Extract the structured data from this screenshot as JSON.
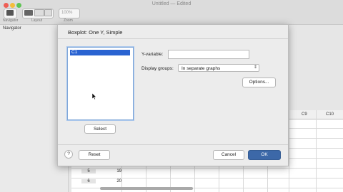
{
  "window": {
    "title": "Untitled — Edited"
  },
  "toolbar": {
    "labels": {
      "navigator": "Navigator",
      "layout": "Layout",
      "zoom": "Zoom"
    },
    "zoom_value": "100%"
  },
  "navigator": {
    "title": "Navigator"
  },
  "worksheet": {
    "columns": [
      "C9",
      "C10"
    ],
    "rows": [
      {
        "num": "5",
        "value": "19"
      },
      {
        "num": "6",
        "value": "20"
      }
    ]
  },
  "dialog": {
    "title": "Boxplot: One Y, Simple",
    "variables": [
      "C1"
    ],
    "select_label": "Select",
    "y_variable_label": "Y-variable:",
    "y_variable_value": "",
    "display_groups_label": "Display groups:",
    "display_groups_value": "In separate graphs",
    "options_label": "Options...",
    "help_label": "?",
    "reset_label": "Reset",
    "cancel_label": "Cancel",
    "ok_label": "OK"
  },
  "colors": {
    "accent": "#3c68a8",
    "selection": "#2a63d1"
  }
}
